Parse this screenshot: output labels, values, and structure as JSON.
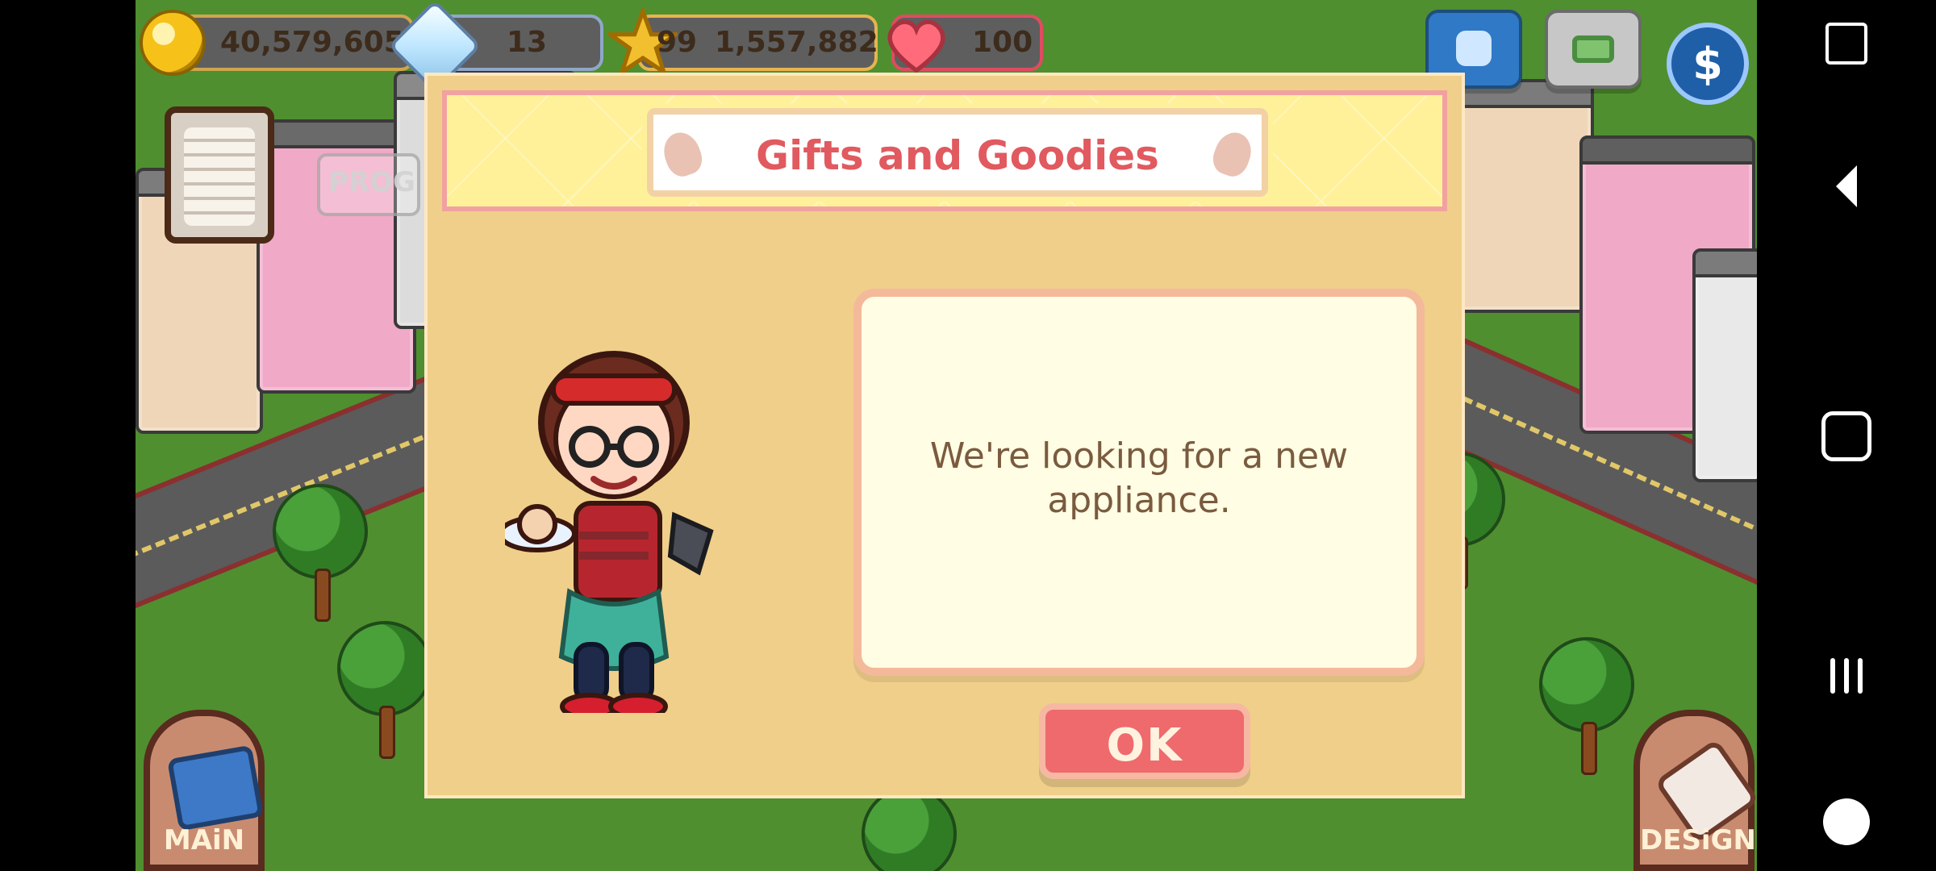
{
  "hud": {
    "coins": "40,579,605",
    "gems": "13",
    "level": "99",
    "xp": "1,557,882",
    "hearts": "100"
  },
  "dialog": {
    "title": "Gifts and Goodies",
    "message": "We're looking for a new appliance.",
    "ok_label": "OK"
  },
  "corner_buttons": {
    "main_label": "MAiN",
    "design_label": "DESiGN"
  },
  "background_sign": {
    "text": "PROG"
  },
  "colors": {
    "dialog_bg": "#f0cf8a",
    "banner_bg": "#fff199",
    "title_red": "#e05a5f",
    "ok_button": "#ef6a6d",
    "message_text": "#7a5b3f"
  },
  "icons": {
    "coin": "coin-icon",
    "gem": "diamond-icon",
    "level": "star-icon",
    "heart": "heart-icon",
    "phone": "phone-icon",
    "camera": "camera-icon",
    "currency": "dollar-icon",
    "clipboard": "clipboard-icon",
    "book": "book-icon",
    "brush": "paintbrush-icon",
    "nav_rotate": "rotate-icon",
    "nav_back": "back-icon",
    "nav_home": "home-icon",
    "nav_recents": "recents-icon",
    "nav_games": "gamepad-icon"
  }
}
